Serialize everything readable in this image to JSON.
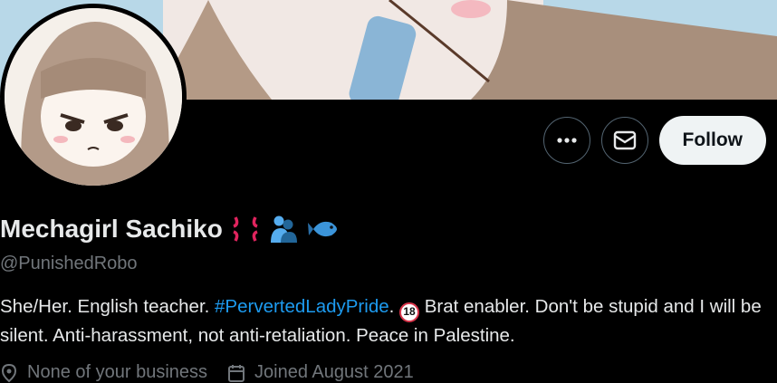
{
  "profile": {
    "display_name": "Mechagirl Sachiko",
    "handle": "@PunishedRobo",
    "name_emojis": [
      "anger-icon",
      "hugging-people-icon",
      "fish-icon"
    ],
    "bio": {
      "part1": "She/Her. English teacher. ",
      "hashtag": "#PervertedLadyPride",
      "part2": ". ",
      "no_under_18_label": "18",
      "part3": " Brat enabler. Don't be stupid and I will be silent. Anti-harassment, not anti-retaliation. Peace in Palestine."
    },
    "location": "None of your business",
    "joined": "Joined August 2021"
  },
  "actions": {
    "follow_label": "Follow"
  },
  "colors": {
    "background": "#000000",
    "text": "#e7e9ea",
    "muted": "#71767b",
    "link": "#1d9bf0",
    "follow_bg": "#eff3f4"
  }
}
